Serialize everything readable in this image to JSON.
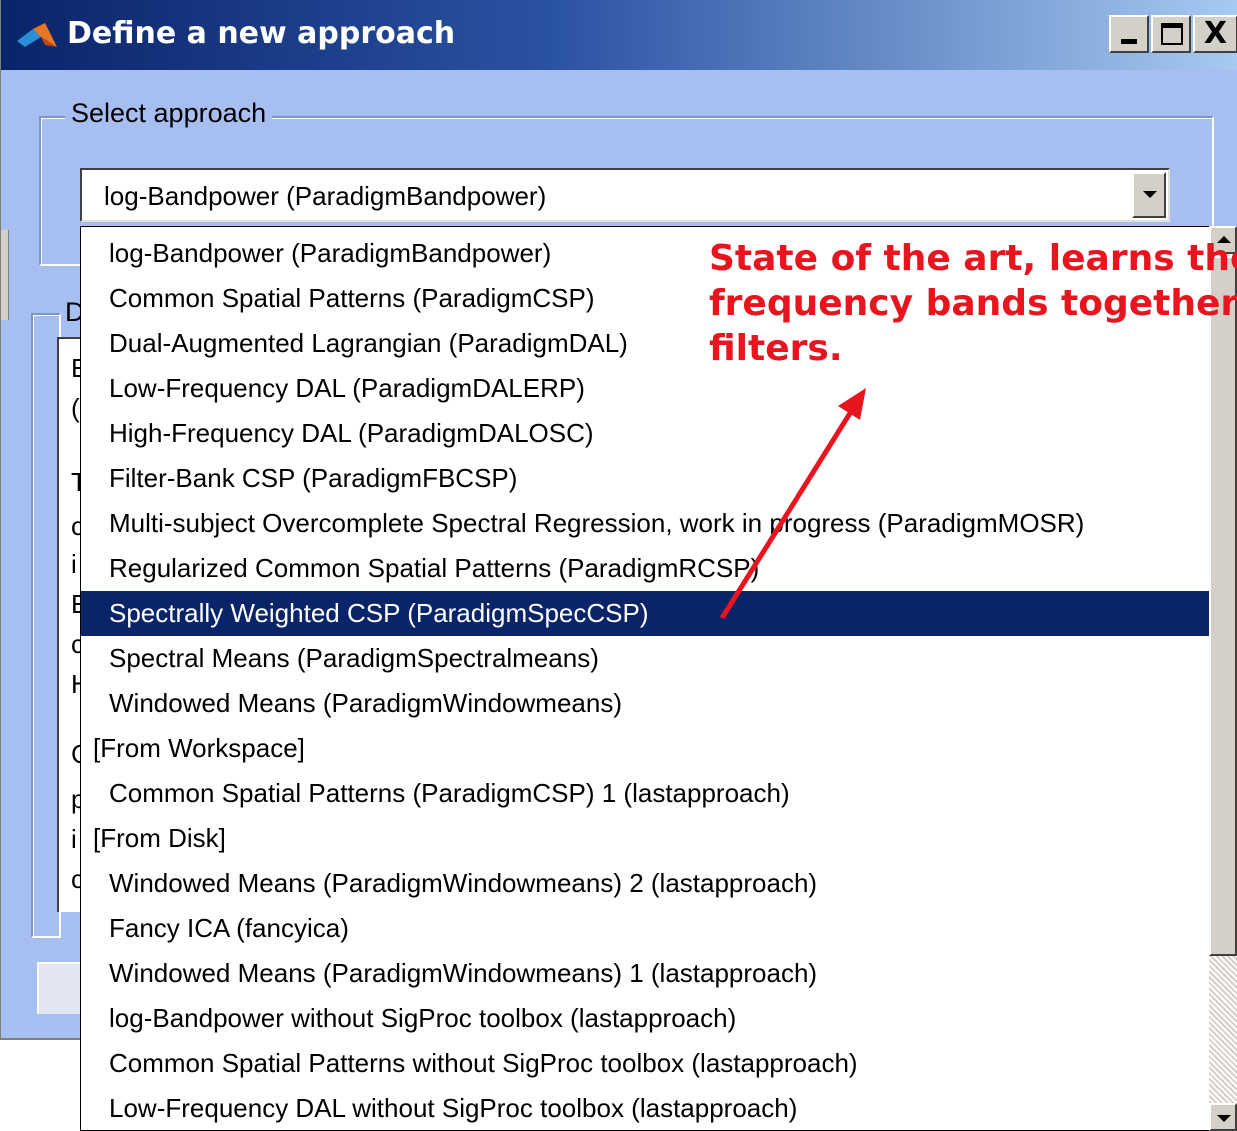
{
  "window": {
    "title": "Define a new approach",
    "controls": {
      "minimize": "_",
      "maximize": "□",
      "close": "X"
    }
  },
  "select_group": {
    "legend": "Select approach",
    "combo_value": "log-Bandpower (ParadigmBandpower)"
  },
  "description_group": {
    "legend_fragment": "D",
    "fragments": [
      "E",
      "(",
      "T",
      "c",
      "i",
      "E",
      "c",
      "H",
      "C",
      "p",
      "i",
      "c"
    ]
  },
  "dropdown": {
    "items": [
      {
        "label": "log-Bandpower (ParadigmBandpower)",
        "type": "item",
        "selected": false
      },
      {
        "label": "Common Spatial Patterns (ParadigmCSP)",
        "type": "item",
        "selected": false
      },
      {
        "label": "Dual-Augmented Lagrangian (ParadigmDAL)",
        "type": "item",
        "selected": false
      },
      {
        "label": "Low-Frequency DAL (ParadigmDALERP)",
        "type": "item",
        "selected": false
      },
      {
        "label": "High-Frequency DAL (ParadigmDALOSC)",
        "type": "item",
        "selected": false
      },
      {
        "label": "Filter-Bank CSP (ParadigmFBCSP)",
        "type": "item",
        "selected": false
      },
      {
        "label": "Multi-subject Overcomplete Spectral Regression, work in progress (ParadigmMOSR)",
        "type": "item",
        "selected": false
      },
      {
        "label": "Regularized Common Spatial Patterns (ParadigmRCSP)",
        "type": "item",
        "selected": false
      },
      {
        "label": "Spectrally Weighted CSP (ParadigmSpecCSP)",
        "type": "item",
        "selected": true
      },
      {
        "label": "Spectral Means (ParadigmSpectralmeans)",
        "type": "item",
        "selected": false
      },
      {
        "label": "Windowed Means (ParadigmWindowmeans)",
        "type": "item",
        "selected": false
      },
      {
        "label": "[From Workspace]",
        "type": "header",
        "selected": false
      },
      {
        "label": "Common Spatial Patterns (ParadigmCSP) 1 (lastapproach)",
        "type": "item",
        "selected": false
      },
      {
        "label": "[From Disk]",
        "type": "header",
        "selected": false
      },
      {
        "label": "Windowed Means (ParadigmWindowmeans) 2 (lastapproach)",
        "type": "item",
        "selected": false
      },
      {
        "label": "Fancy ICA (fancyica)",
        "type": "item",
        "selected": false
      },
      {
        "label": "Windowed Means (ParadigmWindowmeans) 1 (lastapproach)",
        "type": "item",
        "selected": false
      },
      {
        "label": "log-Bandpower without SigProc toolbox (lastapproach)",
        "type": "item",
        "selected": false
      },
      {
        "label": "Common Spatial Patterns without SigProc toolbox (lastapproach)",
        "type": "item",
        "selected": false
      },
      {
        "label": "Low-Frequency DAL without SigProc toolbox (lastapproach)",
        "type": "item",
        "selected": false
      }
    ]
  },
  "annotation": {
    "lines": [
      "State of the art, learns the",
      "frequency bands together w",
      "filters."
    ],
    "color": "#e8141e",
    "target_item": "Spectrally Weighted CSP (ParadigmSpecCSP)"
  },
  "colors": {
    "selection": "#0a246a",
    "dialog_background": "#a6bef0",
    "titlebar_start": "#0a246a"
  }
}
